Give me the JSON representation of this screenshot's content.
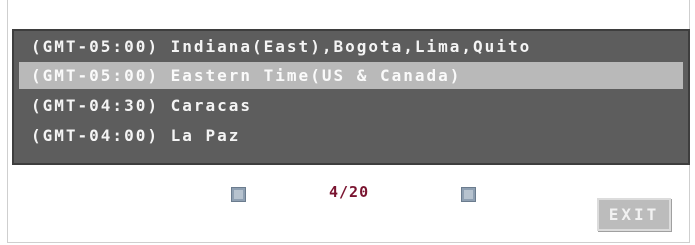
{
  "timezone_list": {
    "items": [
      {
        "label": "(GMT-05:00) Indiana(East),Bogota,Lima,Quito",
        "selected": false
      },
      {
        "label": "(GMT-05:00) Eastern Time(US & Canada)",
        "selected": true
      },
      {
        "label": "(GMT-04:30) Caracas",
        "selected": false
      },
      {
        "label": "(GMT-04:00) La Paz",
        "selected": false
      }
    ]
  },
  "pager": {
    "page_text": "4/20",
    "prev_icon": "square-button-icon",
    "next_icon": "square-button-icon"
  },
  "buttons": {
    "exit_label": "EXIT"
  },
  "colors": {
    "panel": "#5d5d5d",
    "selected_row": "#b9b9b9",
    "page_text": "#7a1430",
    "exit_button": "#bcbcbc"
  }
}
